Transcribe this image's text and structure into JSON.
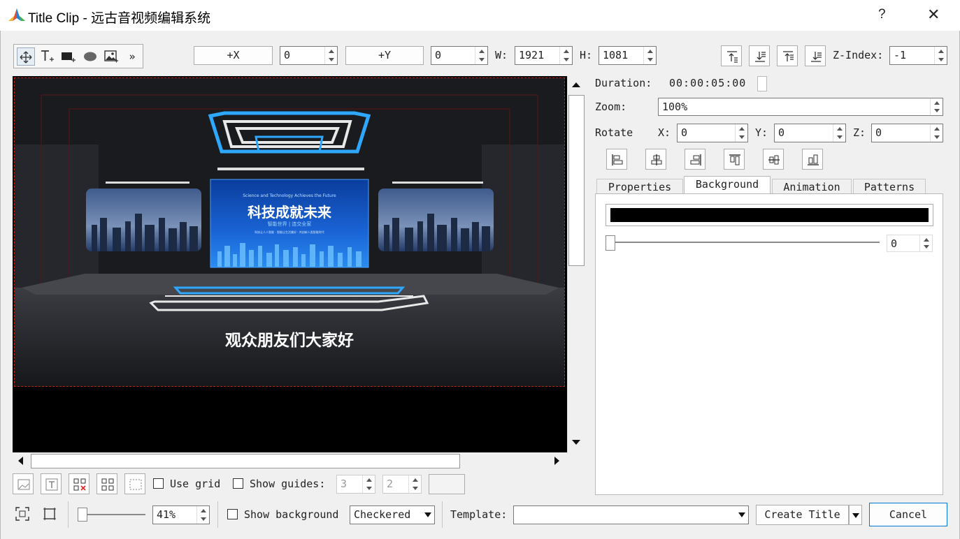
{
  "window": {
    "title": "Title Clip - 远古音视频编辑系统",
    "help": "?",
    "close": "✕"
  },
  "toolbar": {
    "tools": [
      "move-tool",
      "text-tool",
      "rectangle-tool",
      "ellipse-tool",
      "image-tool",
      "more-tools"
    ],
    "more_label": "»",
    "plus_x": "+X",
    "x_value": "0",
    "plus_y": "+Y",
    "y_value": "0",
    "w_label": "W:",
    "w_value": "1921",
    "h_label": "H:",
    "h_value": "1081",
    "zindex_label": "Z-Index:",
    "zindex_value": "-1"
  },
  "stage": {
    "screen_en": "Science and Technology Achieves the Future",
    "screen_title": "科技成就未来",
    "screen_sub": "智能世界 | 连交全家",
    "screen_small": "科技让人人智能 · 智能让生活美好 · 共创新人类智能时代",
    "caption": "观众朋友们大家好"
  },
  "props": {
    "duration_label": "Duration:",
    "duration_value": "00:00:05:00",
    "zoom_label": "Zoom:",
    "zoom_value": "100%",
    "rotate_label": "Rotate",
    "x_label": "X:",
    "x_value": "0",
    "y_label": "Y:",
    "y_value": "0",
    "z_label": "Z:",
    "z_value": "0"
  },
  "tabs": [
    {
      "label": "Properties",
      "active": false
    },
    {
      "label": "Background",
      "active": true
    },
    {
      "label": "Animation",
      "active": false
    },
    {
      "label": "Patterns",
      "active": false
    }
  ],
  "background": {
    "color": "#000000",
    "opacity_value": "0"
  },
  "bottom": {
    "use_grid": "Use grid",
    "show_guides": "Show guides:",
    "guides_a": "3",
    "guides_b": "2",
    "zoom_pct": "41%",
    "show_background": "Show background",
    "bg_mode": "Checkered",
    "template_label": "Template:",
    "template_value": "",
    "create_title": "Create Title",
    "cancel": "Cancel"
  }
}
